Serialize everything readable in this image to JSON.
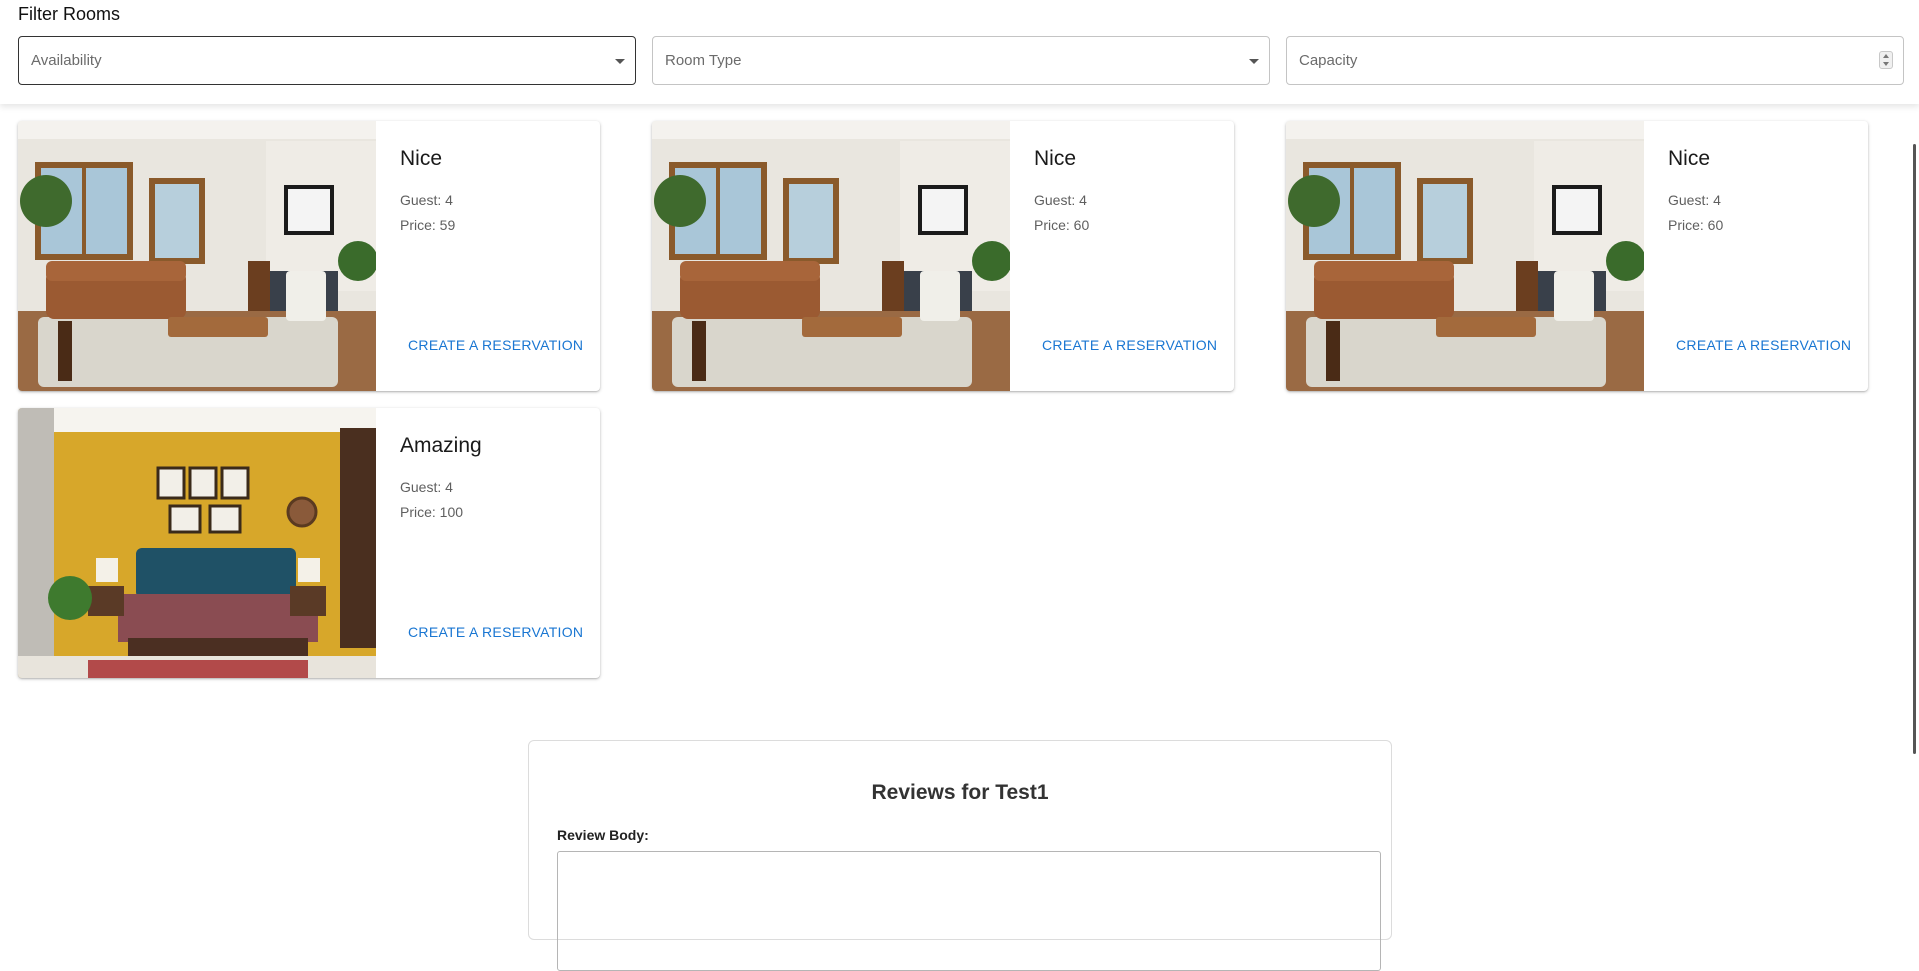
{
  "filters": {
    "title": "Filter Rooms",
    "availability_label": "Availability",
    "room_type_label": "Room Type",
    "capacity_label": "Capacity"
  },
  "rooms": [
    {
      "name": "Nice",
      "guest": "Guest: 4",
      "price": "Price: 59",
      "cta": "CREATE A RESERVATION",
      "image": "living-room-photo"
    },
    {
      "name": "Nice",
      "guest": "Guest: 4",
      "price": "Price: 60",
      "cta": "CREATE A RESERVATION",
      "image": "living-room-photo"
    },
    {
      "name": "Nice",
      "guest": "Guest: 4",
      "price": "Price: 60",
      "cta": "CREATE A RESERVATION",
      "image": "living-room-photo"
    },
    {
      "name": "Amazing",
      "guest": "Guest: 4",
      "price": "Price: 100",
      "cta": "CREATE A RESERVATION",
      "image": "bedroom-photo"
    }
  ],
  "reviews": {
    "title": "Reviews for Test1",
    "body_label": "Review Body:"
  },
  "colors": {
    "accent": "#1976d2",
    "top_border": "#3f3fa8"
  }
}
